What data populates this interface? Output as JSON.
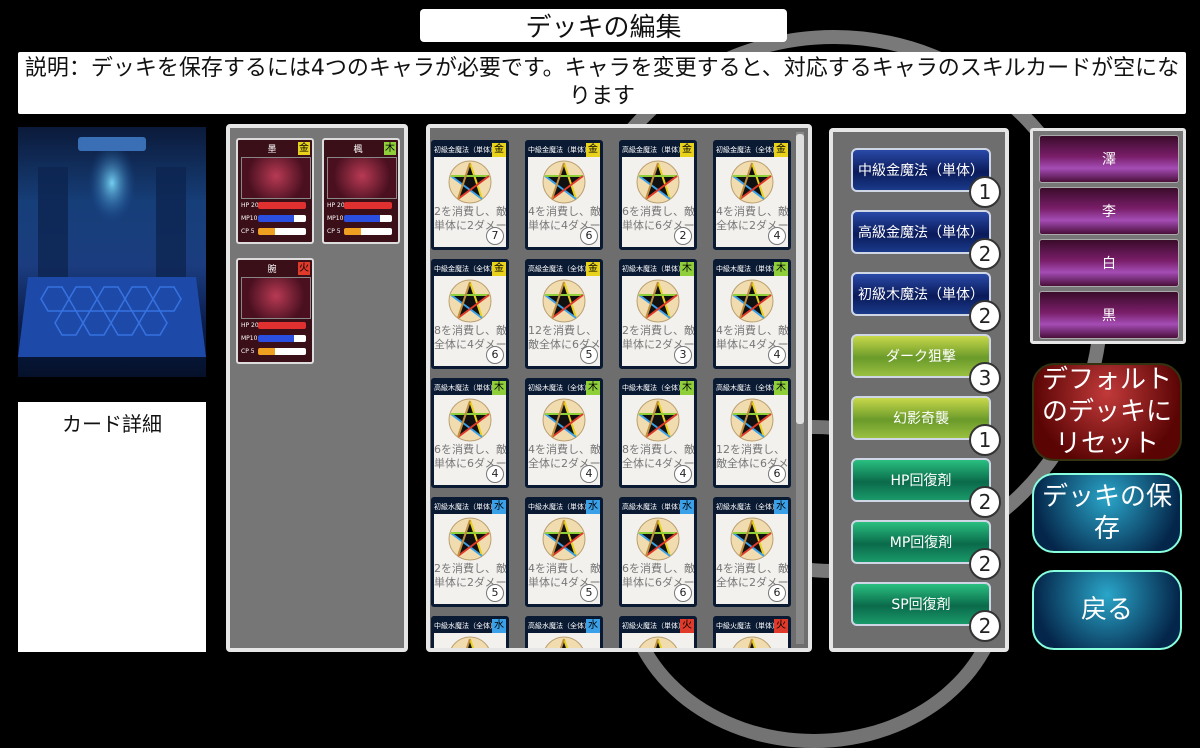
{
  "title": "デッキの編集",
  "description": "説明：デッキを保存するには4つのキャラが必要です。キャラを変更すると、対応するキャラのスキルカードが空になります",
  "detail_label": "カード詳細",
  "characters": [
    {
      "name": "墨",
      "element": "金",
      "element_color": "#e8d21b",
      "hp": "HP 20",
      "mp": "MP10",
      "cp": "CP 5"
    },
    {
      "name": "楓",
      "element": "木",
      "element_color": "#8fcf3a",
      "hp": "HP 20",
      "mp": "MP10",
      "cp": "CP 5"
    },
    {
      "name": "腕",
      "element": "火",
      "element_color": "#e03a2a",
      "hp": "HP 20",
      "mp": "MP10",
      "cp": "CP 5"
    }
  ],
  "cards": [
    {
      "title": "初級金魔法（単体）",
      "element": "金",
      "element_color": "#e8d21b",
      "text1": "2を消費し、敵",
      "text2": "単体に2ダメー",
      "count": "7"
    },
    {
      "title": "中級金魔法（単体）",
      "element": "金",
      "element_color": "#e8d21b",
      "text1": "4を消費し、敵",
      "text2": "単体に4ダメー",
      "count": "6"
    },
    {
      "title": "高級金魔法（単体）",
      "element": "金",
      "element_color": "#e8d21b",
      "text1": "6を消費し、敵",
      "text2": "単体に6ダメー",
      "count": "2"
    },
    {
      "title": "初級金魔法（全体）",
      "element": "金",
      "element_color": "#e8d21b",
      "text1": "4を消費し、敵",
      "text2": "全体に2ダメー",
      "count": "4"
    },
    {
      "title": "中級金魔法（全体）",
      "element": "金",
      "element_color": "#e8d21b",
      "text1": "8を消費し、敵",
      "text2": "全体に4ダメー",
      "count": "6"
    },
    {
      "title": "高級金魔法（全体）",
      "element": "金",
      "element_color": "#e8d21b",
      "text1": "12を消費し、",
      "text2": "敵全体に6ダメ",
      "count": "5"
    },
    {
      "title": "初級木魔法（単体）",
      "element": "木",
      "element_color": "#8fcf3a",
      "text1": "2を消費し、敵",
      "text2": "単体に2ダメー",
      "count": "3"
    },
    {
      "title": "中級木魔法（単体）",
      "element": "木",
      "element_color": "#8fcf3a",
      "text1": "4を消費し、敵",
      "text2": "単体に4ダメー",
      "count": "4"
    },
    {
      "title": "高級木魔法（単体）",
      "element": "木",
      "element_color": "#8fcf3a",
      "text1": "6を消費し、敵",
      "text2": "単体に6ダメー",
      "count": "4"
    },
    {
      "title": "初級木魔法（全体）",
      "element": "木",
      "element_color": "#8fcf3a",
      "text1": "4を消費し、敵",
      "text2": "全体に2ダメー",
      "count": "4"
    },
    {
      "title": "中級木魔法（全体）",
      "element": "木",
      "element_color": "#8fcf3a",
      "text1": "8を消費し、敵",
      "text2": "全体に4ダメー",
      "count": "4"
    },
    {
      "title": "高級木魔法（全体）",
      "element": "木",
      "element_color": "#8fcf3a",
      "text1": "12を消費し、",
      "text2": "敵全体に6ダメ",
      "count": "6"
    },
    {
      "title": "初級水魔法（単体）",
      "element": "水",
      "element_color": "#3aa0e8",
      "text1": "2を消費し、敵",
      "text2": "単体に2ダメー",
      "count": "5"
    },
    {
      "title": "中級水魔法（単体）",
      "element": "水",
      "element_color": "#3aa0e8",
      "text1": "4を消費し、敵",
      "text2": "単体に4ダメー",
      "count": "5"
    },
    {
      "title": "高級水魔法（単体）",
      "element": "水",
      "element_color": "#3aa0e8",
      "text1": "6を消費し、敵",
      "text2": "単体に6ダメー",
      "count": "6"
    },
    {
      "title": "初級水魔法（全体）",
      "element": "水",
      "element_color": "#3aa0e8",
      "text1": "4を消費し、敵",
      "text2": "全体に2ダメー",
      "count": "6"
    },
    {
      "title": "中級水魔法（全体）",
      "element": "水",
      "element_color": "#3aa0e8",
      "text1": "",
      "text2": "",
      "count": ""
    },
    {
      "title": "高級水魔法（全体）",
      "element": "水",
      "element_color": "#3aa0e8",
      "text1": "",
      "text2": "",
      "count": ""
    },
    {
      "title": "初級火魔法（単体）",
      "element": "火",
      "element_color": "#e03a2a",
      "text1": "",
      "text2": "",
      "count": ""
    },
    {
      "title": "中級火魔法（単体）",
      "element": "火",
      "element_color": "#e03a2a",
      "text1": "",
      "text2": "",
      "count": ""
    }
  ],
  "deck": [
    {
      "label": "中級金魔法（単体）",
      "count": "1",
      "style": "blue"
    },
    {
      "label": "高級金魔法（単体）",
      "count": "2",
      "style": "blue"
    },
    {
      "label": "初級木魔法（単体）",
      "count": "2",
      "style": "blue"
    },
    {
      "label": "ダーク狙撃",
      "count": "3",
      "style": "yellowgreen"
    },
    {
      "label": "幻影奇襲",
      "count": "1",
      "style": "yellowgreen"
    },
    {
      "label": "HP回復剤",
      "count": "2",
      "style": "green"
    },
    {
      "label": "MP回復剤",
      "count": "2",
      "style": "green"
    },
    {
      "label": "SP回復剤",
      "count": "2",
      "style": "green"
    }
  ],
  "team": [
    {
      "name": "澤"
    },
    {
      "name": "李"
    },
    {
      "name": "白"
    },
    {
      "name": "黒"
    }
  ],
  "buttons": {
    "reset": "デフォルトのデッキにリセット",
    "save": "デッキの保存",
    "back": "戻る"
  }
}
